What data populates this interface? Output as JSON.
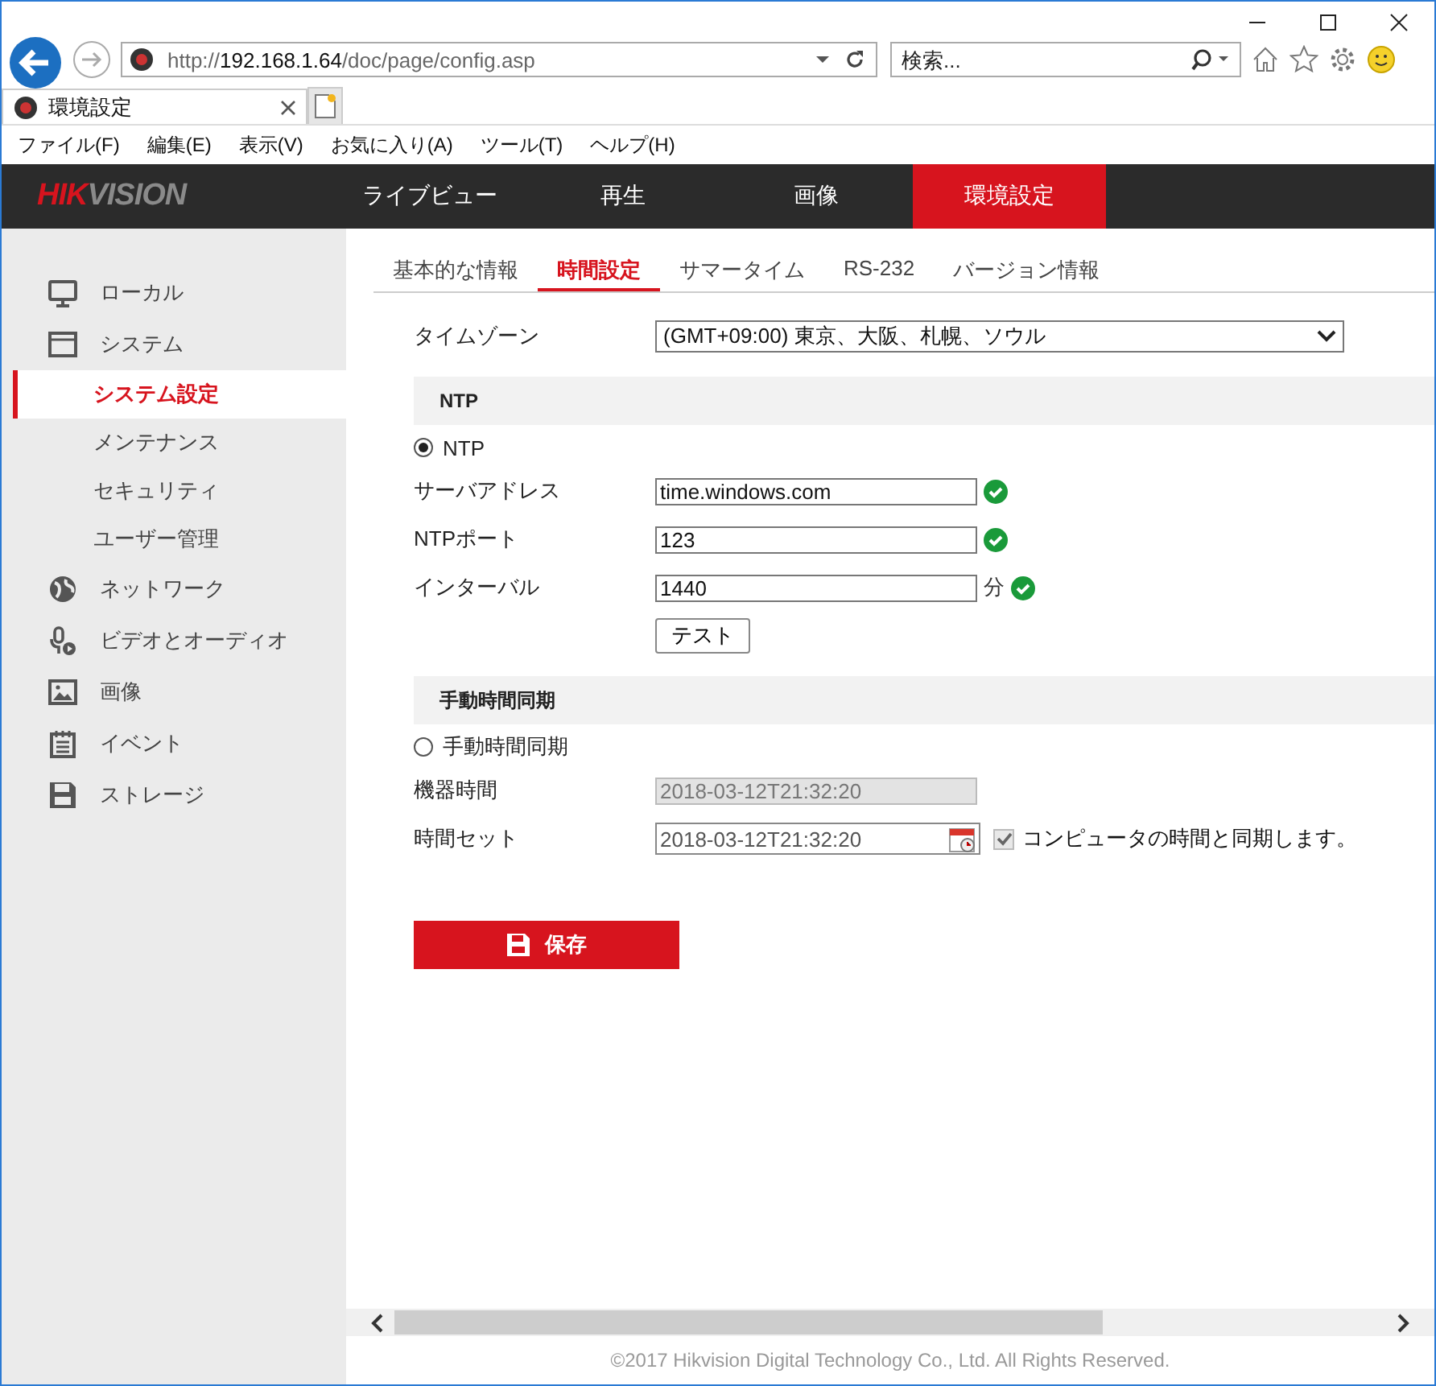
{
  "browser": {
    "address_scheme": "http://",
    "address_host": "192.168.1.64",
    "address_path": "/doc/page/config.asp",
    "search": {
      "placeholder": "検索..."
    },
    "tab_title": "環境設定",
    "menu": [
      "ファイル(F)",
      "編集(E)",
      "表示(V)",
      "お気に入り(A)",
      "ツール(T)",
      "ヘルプ(H)"
    ]
  },
  "header": {
    "logo_red": "HIK",
    "logo_grey": "VISION",
    "nav": [
      {
        "label": "ライブビュー",
        "selected": false
      },
      {
        "label": "再生",
        "selected": false
      },
      {
        "label": "画像",
        "selected": false
      },
      {
        "label": "環境設定",
        "selected": true
      }
    ]
  },
  "sidebar": {
    "items": [
      {
        "label": "ローカル",
        "kind": "section",
        "selected": false
      },
      {
        "label": "システム",
        "kind": "section",
        "selected": false,
        "children": [
          {
            "label": "システム設定",
            "selected": true
          },
          {
            "label": "メンテナンス",
            "selected": false
          },
          {
            "label": "セキュリティ",
            "selected": false
          },
          {
            "label": "ユーザー管理",
            "selected": false
          }
        ]
      },
      {
        "label": "ネットワーク",
        "kind": "section",
        "selected": false
      },
      {
        "label": "ビデオとオーディオ",
        "kind": "section",
        "selected": false
      },
      {
        "label": "画像",
        "kind": "section",
        "selected": false
      },
      {
        "label": "イベント",
        "kind": "section",
        "selected": false
      },
      {
        "label": "ストレージ",
        "kind": "section",
        "selected": false
      }
    ]
  },
  "subtabs": [
    {
      "label": "基本的な情報",
      "selected": false
    },
    {
      "label": "時間設定",
      "selected": true
    },
    {
      "label": "サマータイム",
      "selected": false
    },
    {
      "label": "RS-232",
      "selected": false
    },
    {
      "label": "バージョン情報",
      "selected": false
    }
  ],
  "form": {
    "timezone": {
      "label": "タイムゾーン",
      "value": "(GMT+09:00) 東京、大阪、札幌、ソウル"
    },
    "ntp": {
      "heading": "NTP",
      "radio": {
        "label": "NTP",
        "selected": true
      },
      "fields": [
        {
          "label": "サーバアドレス",
          "value": "time.windows.com",
          "valid": true
        },
        {
          "label": "NTPポート",
          "value": "123",
          "valid": true
        },
        {
          "label": "インターバル",
          "value": "1440",
          "unit": "分",
          "valid": true
        }
      ],
      "test_button": "テスト"
    },
    "manual": {
      "heading": "手動時間同期",
      "radio": {
        "label": "手動時間同期",
        "selected": false
      },
      "device_time": {
        "label": "機器時間",
        "value": "2018-03-12T21:32:20",
        "disabled": true
      },
      "set_time": {
        "label": "時間セット",
        "value": "2018-03-12T21:32:20"
      },
      "sync": {
        "label": "コンピュータの時間と同期します。",
        "checked": true
      }
    },
    "save_button": "保存"
  },
  "footer": "©2017 Hikvision Digital Technology Co., Ltd. All Rights Reserved."
}
